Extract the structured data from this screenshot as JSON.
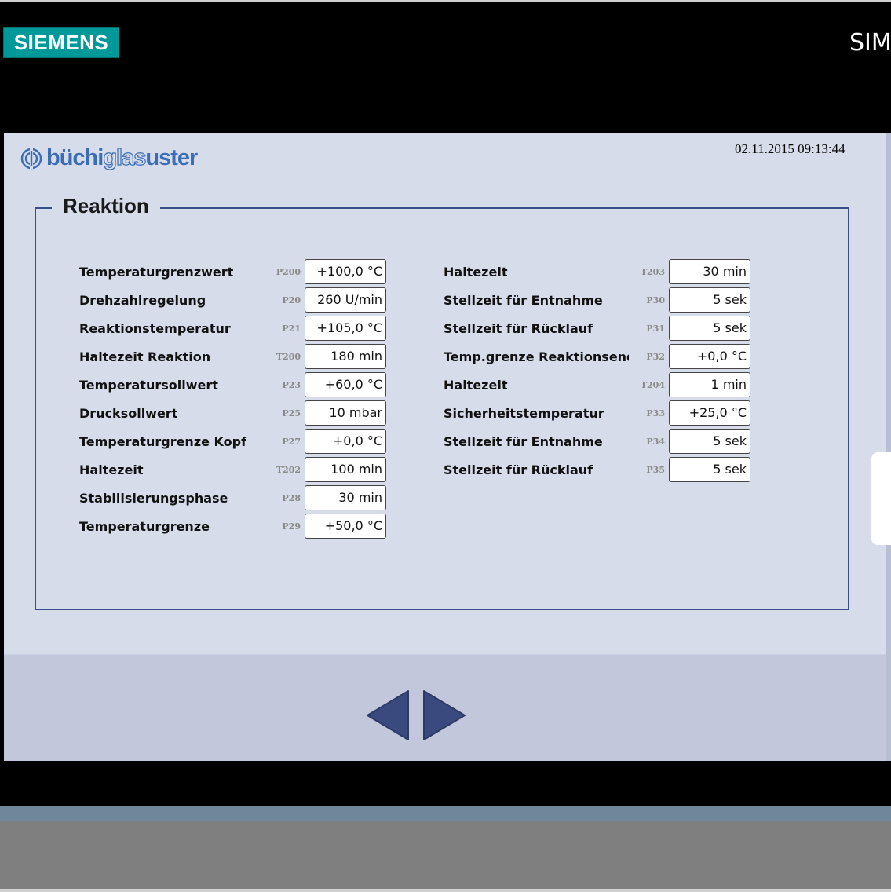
{
  "bezel": {
    "brand": "SIEMENS",
    "right_text": "SIM"
  },
  "header": {
    "logo_part1": "büchi",
    "logo_part2": "glas",
    "logo_part3": "uster",
    "datetime": "02.11.2015 09:13:44"
  },
  "panel": {
    "title": "Reaktion",
    "left": [
      {
        "label": "Temperaturgrenzwert",
        "code": "P200",
        "value": "+100,0 °C"
      },
      {
        "label": "Drehzahlregelung",
        "code": "P20",
        "value": "260 U/min"
      },
      {
        "label": "Reaktionstemperatur",
        "code": "P21",
        "value": "+105,0 °C"
      },
      {
        "label": "Haltezeit Reaktion",
        "code": "T200",
        "value": "180 min"
      },
      {
        "label": "Temperatursollwert",
        "code": "P23",
        "value": "+60,0 °C"
      },
      {
        "label": "Drucksollwert",
        "code": "P25",
        "value": "10 mbar"
      },
      {
        "label": "Temperaturgrenze Kopf",
        "code": "P27",
        "value": "+0,0 °C"
      },
      {
        "label": "Haltezeit",
        "code": "T202",
        "value": "100 min"
      },
      {
        "label": "Stabilisierungsphase",
        "code": "P28",
        "value": "30 min"
      },
      {
        "label": "Temperaturgrenze",
        "code": "P29",
        "value": "+50,0 °C"
      }
    ],
    "right": [
      {
        "label": "Haltezeit",
        "code": "T203",
        "value": "30 min"
      },
      {
        "label": "Stellzeit für Entnahme",
        "code": "P30",
        "value": "5 sek"
      },
      {
        "label": "Stellzeit für Rücklauf",
        "code": "P31",
        "value": "5 sek"
      },
      {
        "label": "Temp.grenze Reaktionsende",
        "code": "P32",
        "value": "+0,0 °C"
      },
      {
        "label": "Haltezeit",
        "code": "T204",
        "value": "1 min"
      },
      {
        "label": "Sicherheitstemperatur",
        "code": "P33",
        "value": "+25,0 °C"
      },
      {
        "label": "Stellzeit für Entnahme",
        "code": "P34",
        "value": "5 sek"
      },
      {
        "label": "Stellzeit für Rücklauf",
        "code": "P35",
        "value": "5 sek"
      }
    ]
  },
  "navigation": {
    "prev_icon": "triangle-left-icon",
    "next_icon": "triangle-right-icon"
  },
  "colors": {
    "screen_bg": "#d7dcea",
    "nav_bar_bg": "#c2c7db",
    "accent": "#3a4f8a",
    "brand_teal": "#009999",
    "logo_blue": "#3a6db5"
  }
}
